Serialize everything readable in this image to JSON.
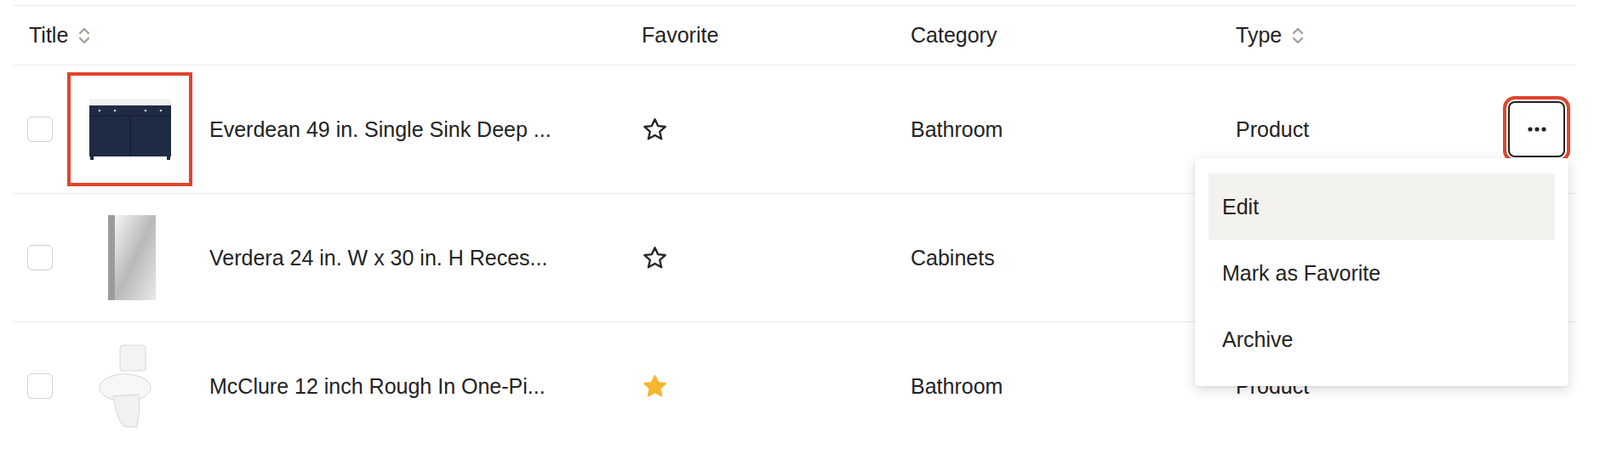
{
  "table": {
    "columns": [
      {
        "label": "Title",
        "sortable": true
      },
      {
        "label": "Favorite",
        "sortable": false
      },
      {
        "label": "Category",
        "sortable": false
      },
      {
        "label": "Type",
        "sortable": true
      }
    ],
    "rows": [
      {
        "checked": false,
        "title": "Everdean 49 in. Single Sink Deep ...",
        "favorite": false,
        "category": "Bathroom",
        "type": "Product",
        "thumbnail_highlighted": true,
        "menu_open": true
      },
      {
        "checked": false,
        "title": "Verdera 24 in. W x 30 in. H Reces...",
        "favorite": false,
        "category": "Cabinets",
        "thumbnail_highlighted": false,
        "menu_open": false
      },
      {
        "checked": false,
        "title": "McClure 12 inch Rough In One-Pi...",
        "favorite": true,
        "category": "Bathroom",
        "type": "Product",
        "thumbnail_highlighted": false,
        "menu_open": false
      }
    ]
  },
  "menu": {
    "items": [
      {
        "label": "Edit",
        "selected": true
      },
      {
        "label": "Mark as Favorite",
        "selected": false
      },
      {
        "label": "Archive",
        "selected": false
      }
    ]
  }
}
